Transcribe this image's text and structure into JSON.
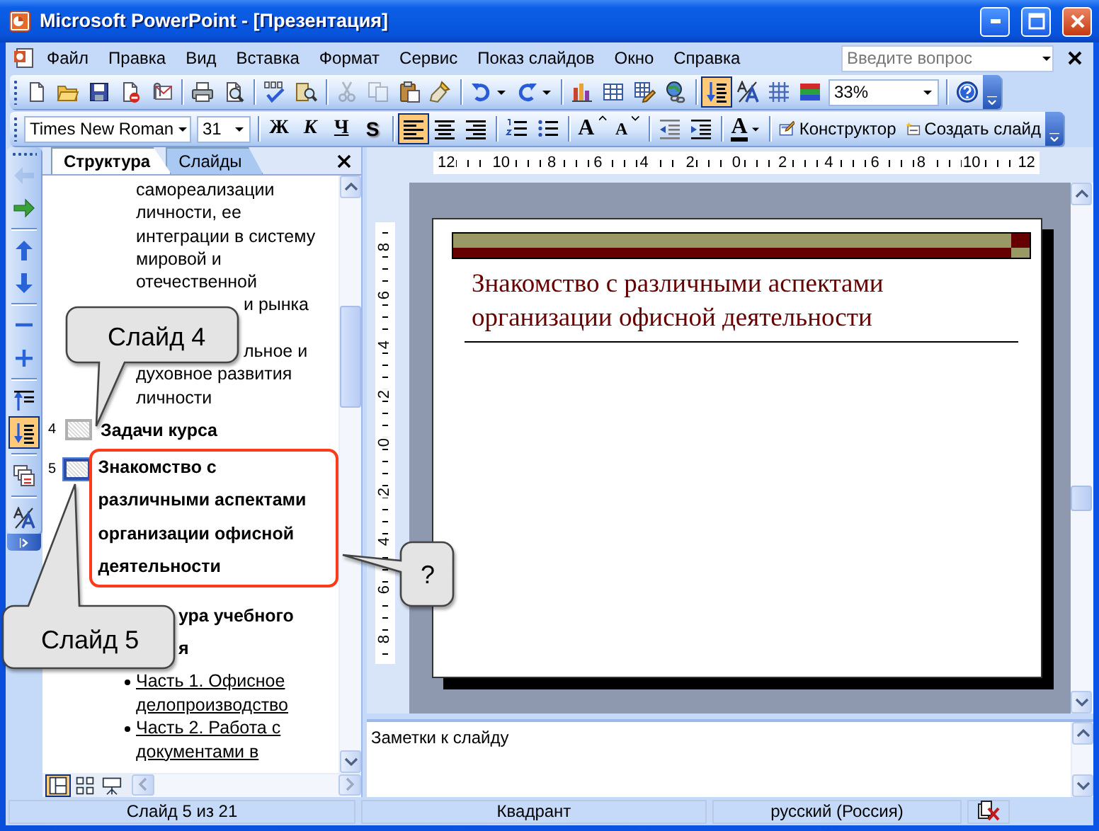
{
  "window": {
    "title": "Microsoft PowerPoint - [Презентация]"
  },
  "menu_bar": {
    "items": [
      "Файл",
      "Правка",
      "Вид",
      "Вставка",
      "Формат",
      "Сервис",
      "Показ слайдов",
      "Окно",
      "Справка"
    ],
    "help_box": {
      "placeholder": "Введите вопрос"
    }
  },
  "standard_toolbar": {
    "groups": [
      [
        {
          "kind": "new",
          "pressed": false,
          "disabled": false
        },
        {
          "kind": "open",
          "pressed": false,
          "disabled": false
        },
        {
          "kind": "save",
          "pressed": false,
          "disabled": false
        },
        {
          "kind": "permission",
          "pressed": false,
          "disabled": false
        },
        {
          "kind": "email",
          "pressed": false,
          "disabled": false
        }
      ],
      [
        {
          "kind": "print",
          "pressed": false,
          "disabled": false
        },
        {
          "kind": "preview",
          "pressed": false,
          "disabled": false
        }
      ],
      [
        {
          "kind": "spelling",
          "pressed": false,
          "disabled": false
        },
        {
          "kind": "research",
          "pressed": false,
          "disabled": false
        }
      ],
      [
        {
          "kind": "cut",
          "pressed": false,
          "disabled": true
        },
        {
          "kind": "copy",
          "pressed": false,
          "disabled": true
        },
        {
          "kind": "paste",
          "pressed": false,
          "disabled": false
        },
        {
          "kind": "painter",
          "pressed": false,
          "disabled": false
        }
      ],
      [
        {
          "kind": "undo",
          "pressed": false,
          "disabled": false
        },
        {
          "kind": "redo",
          "pressed": false,
          "disabled": false
        }
      ],
      [
        {
          "kind": "chart",
          "pressed": false,
          "disabled": false
        },
        {
          "kind": "table",
          "pressed": false,
          "disabled": false
        },
        {
          "kind": "tables_borders",
          "pressed": false,
          "disabled": false
        },
        {
          "kind": "hyperlink",
          "pressed": false,
          "disabled": false
        }
      ],
      [
        {
          "kind": "expand_all",
          "pressed": true,
          "disabled": false
        },
        {
          "kind": "formatting",
          "pressed": false,
          "disabled": false
        },
        {
          "kind": "grid",
          "pressed": false,
          "disabled": false
        },
        {
          "kind": "color_view",
          "pressed": false,
          "disabled": false
        },
        {
          "kind": "zoom",
          "value": "33%"
        }
      ],
      [
        {
          "kind": "help",
          "pressed": false,
          "disabled": false
        }
      ]
    ]
  },
  "formatting_toolbar": {
    "groups": [
      [
        {
          "kind": "font",
          "value": "Times New Roman"
        },
        {
          "kind": "size",
          "value": "31"
        }
      ],
      [
        {
          "kind": "bold",
          "label": "Ж",
          "pressed": false
        },
        {
          "kind": "italic",
          "label": "К",
          "pressed": false
        },
        {
          "kind": "underline",
          "label": "Ч",
          "pressed": false
        },
        {
          "kind": "shadow",
          "label": "S",
          "pressed": false
        }
      ],
      [
        {
          "kind": "align_left",
          "pressed": true
        },
        {
          "kind": "align_center",
          "pressed": false
        },
        {
          "kind": "align_right",
          "pressed": false
        }
      ],
      [
        {
          "kind": "numbering",
          "pressed": false
        },
        {
          "kind": "bullets",
          "pressed": false
        }
      ],
      [
        {
          "kind": "grow_font",
          "label": "A",
          "pressed": false
        },
        {
          "kind": "shrink_font",
          "label": "A",
          "pressed": false
        }
      ],
      [
        {
          "kind": "outdent",
          "pressed": false
        },
        {
          "kind": "indent",
          "pressed": false
        }
      ],
      [
        {
          "kind": "font_color",
          "label": "A",
          "pressed": false
        }
      ],
      [
        {
          "kind": "design",
          "label": "Конструктор",
          "pressed": false
        },
        {
          "kind": "new_slide",
          "label": "Создать слайд",
          "pressed": false
        }
      ]
    ]
  },
  "outline_toolbar": {
    "groups": [
      [
        {
          "kind": "promote",
          "pressed": false,
          "disabled": true
        },
        {
          "kind": "demote",
          "pressed": false,
          "disabled": false
        }
      ],
      [
        {
          "kind": "move_up",
          "pressed": false,
          "disabled": false
        },
        {
          "kind": "move_down",
          "pressed": false,
          "disabled": false
        }
      ],
      [
        {
          "kind": "collapse",
          "pressed": false,
          "disabled": false
        },
        {
          "kind": "expand",
          "pressed": false,
          "disabled": false
        }
      ],
      [
        {
          "kind": "collapse_all",
          "pressed": false,
          "disabled": false
        },
        {
          "kind": "expand_all",
          "pressed": true,
          "disabled": false
        }
      ],
      [
        {
          "kind": "summary_slide",
          "pressed": false,
          "disabled": false
        }
      ],
      [
        {
          "kind": "show_formatting",
          "pressed": false,
          "disabled": false
        }
      ]
    ]
  },
  "outline_pane": {
    "tabs": [
      {
        "label": "Структура",
        "selected": true
      },
      {
        "label": "Слайды",
        "selected": false
      }
    ],
    "items": [
      {
        "kind": "text",
        "text": "самореализации"
      },
      {
        "kind": "text",
        "text": "личности, ее"
      },
      {
        "kind": "text",
        "text": "интеграции в систему"
      },
      {
        "kind": "text",
        "text": "мировой и"
      },
      {
        "kind": "text",
        "text": "отечественной"
      },
      {
        "kind": "text_partial",
        "text": "и рынка"
      },
      {
        "kind": "text_partial",
        "text": "льное и"
      },
      {
        "kind": "text",
        "text": "духовное развития"
      },
      {
        "kind": "text",
        "text": "личности"
      },
      {
        "kind": "slide",
        "number": "4",
        "title_lines": [
          "Задачи курса"
        ],
        "selected": false
      },
      {
        "kind": "slide",
        "number": "5",
        "title_lines": [
          "Знакомство с",
          "различными аспектами",
          "организации офисной",
          "деятельности"
        ],
        "selected": true
      },
      {
        "kind": "slide_partial",
        "title_lines": [
          "ура учебного",
          "я"
        ],
        "selected": false
      },
      {
        "kind": "bullet",
        "text": "Часть 1. Офисное делопроизводство"
      },
      {
        "kind": "bullet",
        "text": "Часть 2. Работа с документами в"
      }
    ],
    "view_buttons": [
      {
        "kind": "normal",
        "pressed": true
      },
      {
        "kind": "sorter",
        "pressed": false
      },
      {
        "kind": "slideshow",
        "pressed": false
      }
    ]
  },
  "rulers": {
    "horizontal": [
      "12",
      "10",
      "8",
      "6",
      "4",
      "2",
      "0",
      "2",
      "4",
      "6",
      "8",
      "10",
      "12"
    ],
    "vertical": [
      "8",
      "6",
      "4",
      "2",
      "0",
      "2",
      "4",
      "6",
      "8"
    ]
  },
  "slide": {
    "title": "Знакомство с различными аспектами организации офисной деятельности"
  },
  "notes": {
    "text": "Заметки к слайду"
  },
  "status_bar": {
    "items": [
      "Слайд 5 из 21",
      "Квадрант",
      "русский (Россия)"
    ]
  },
  "callouts": [
    {
      "text": "Слайд 4"
    },
    {
      "text": "Слайд 5"
    },
    {
      "text": "?"
    }
  ]
}
